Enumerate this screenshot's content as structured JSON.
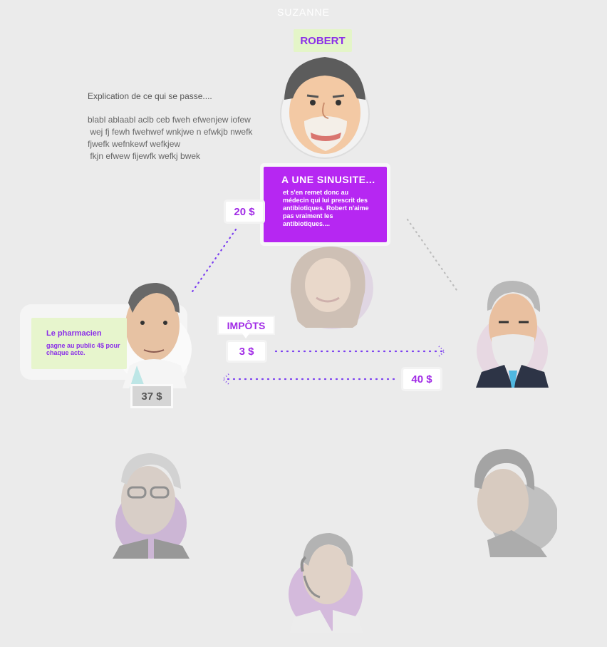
{
  "header": {
    "top_name": "SUZANNE"
  },
  "robert": {
    "name": "ROBERT"
  },
  "explanation": {
    "title": "Explication de ce qui se passe....",
    "lines": [
      "blabl ablaabl aclb ceb fweh efwenjew iofew",
      " wej fj fewh fwehwef wnkjwe n efwkjb nwefk",
      "fjwefk wefnkewf wefkjew",
      " fkjn efwew fijewfk wefkj bwek"
    ]
  },
  "situation_card": {
    "title": "A UNE SINUSITE...",
    "body": "et s'en remet donc au médecin qui lui prescrit des antibiotiques. Robert n'aime pas vraiment les antibiotiques...."
  },
  "money": {
    "doctor": "20 $",
    "taxes_label": "IMPÔTS",
    "taxes": "3 $",
    "government": "40 $",
    "pharmacist_total": "37 $"
  },
  "pharmacist_card": {
    "title": "Le pharmacien",
    "body": "gagne au public 4$ pour chaque acte."
  },
  "colors": {
    "accent": "#b627f2",
    "label_text": "#8b2fe8",
    "label_bg": "#e4f5c8",
    "background": "#ebebeb",
    "dotted_line": "#7b3ff0"
  }
}
